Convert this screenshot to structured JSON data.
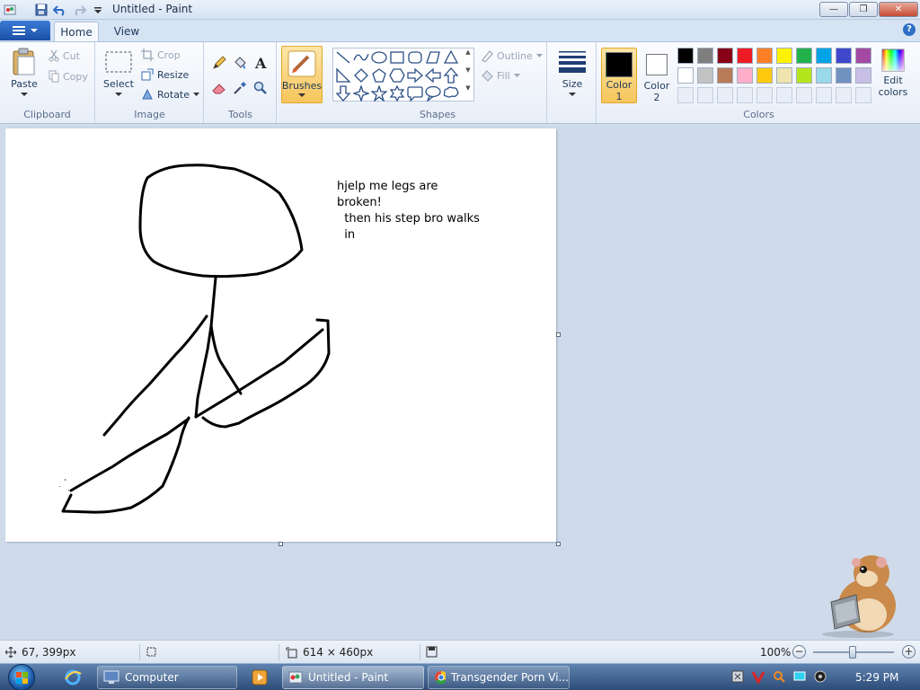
{
  "window": {
    "title": "Untitled - Paint",
    "minimize_label": "—",
    "maximize_label": "❐",
    "close_label": "✕"
  },
  "tabs": [
    {
      "label": "Home",
      "active": true
    },
    {
      "label": "View",
      "active": false
    }
  ],
  "help_label": "?",
  "ribbon": {
    "clipboard": {
      "group_label": "Clipboard",
      "paste": "Paste",
      "cut": "Cut",
      "copy": "Copy"
    },
    "image": {
      "group_label": "Image",
      "select": "Select",
      "crop": "Crop",
      "resize": "Resize",
      "rotate": "Rotate"
    },
    "tools": {
      "group_label": "Tools"
    },
    "brushes": {
      "label": "Brushes"
    },
    "shapes": {
      "group_label": "Shapes",
      "outline": "Outline",
      "fill": "Fill"
    },
    "size": {
      "label": "Size"
    },
    "colors": {
      "group_label": "Colors",
      "color1_line1": "Color",
      "color1_line2": "1",
      "color2_line1": "Color",
      "color2_line2": "2",
      "edit_line1": "Edit",
      "edit_line2": "colors",
      "color1_value": "#000000",
      "color2_value": "#ffffff",
      "palette_row1": [
        "#000000",
        "#7f7f7f",
        "#880015",
        "#ed1c24",
        "#ff7f27",
        "#fff200",
        "#22b14c",
        "#00a2e8",
        "#3f48cc",
        "#a349a4"
      ],
      "palette_row2": [
        "#ffffff",
        "#c3c3c3",
        "#b97a57",
        "#ffaec9",
        "#ffc90e",
        "#efe4b0",
        "#b5e61d",
        "#99d9ea",
        "#7092be",
        "#c8bfe7"
      ]
    }
  },
  "canvas": {
    "text_lines": [
      "hjelp me legs are",
      "broken!",
      "  then his step bro walks",
      "  in"
    ]
  },
  "status": {
    "cursor_pos": "67, 399px",
    "image_size": "614 × 460px",
    "zoom": "100%"
  },
  "taskbar": {
    "computer": "Computer",
    "paint": "Untitled - Paint",
    "chrome": "Transgender Porn Vi...",
    "clock": "5:29 PM"
  }
}
